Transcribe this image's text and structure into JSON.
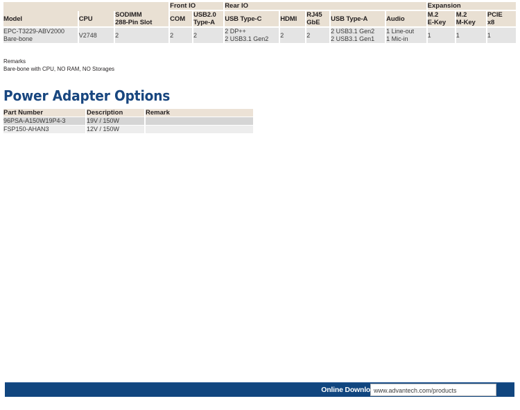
{
  "spec_table": {
    "group_headers": [
      {
        "label": "",
        "colspan": 3,
        "blank": true
      },
      {
        "label": "Front IO",
        "colspan": 2,
        "blank": false
      },
      {
        "label": "Rear IO",
        "colspan": 5,
        "blank": false
      },
      {
        "label": "Expansion",
        "colspan": 3,
        "blank": false
      }
    ],
    "columns": [
      "Model",
      "CPU",
      "SODIMM\n288-Pin Slot",
      "COM",
      "USB2.0\nType-A",
      "USB Type-C",
      "HDMI",
      "RJ45\nGbE",
      "USB Type-A",
      "Audio",
      "M.2\nE-Key",
      "M.2\nM-Key",
      "PCIE\nx8"
    ],
    "rows": [
      {
        "model": "EPC-T3229-ABV2000\nBare-bone",
        "cpu": "V2748",
        "sodimm": "2",
        "com": "2",
        "usb20_type_a": "2",
        "usb_type_c": "2 DP++\n2 USB3.1 Gen2",
        "hdmi": "2",
        "rj45_gbe": "2",
        "usb_type_a": "2 USB3.1 Gen2\n2 USB3.1 Gen1",
        "audio": "1 Line-out\n1 Mic-in",
        "m2_e_key": "1",
        "m2_m_key": "1",
        "pcie_x8": "1"
      }
    ]
  },
  "remarks": {
    "title": "Remarks",
    "text": "Bare-bone with CPU, NO RAM, NO Storages"
  },
  "power_section": {
    "title": "Power Adapter Options",
    "columns": [
      "Part Number",
      "Description",
      "Remark"
    ],
    "rows": [
      {
        "part_number": "96PSA-A150W19P4-3",
        "description": "19V / 150W",
        "remark": ""
      },
      {
        "part_number": "FSP150-AHAN3",
        "description": "12V / 150W",
        "remark": ""
      }
    ]
  },
  "footer": {
    "label": "Online Download",
    "url": "www.advantech.com/products"
  },
  "colors": {
    "header_beige": "#e9e0d3",
    "data_gray": "#e4e4e4",
    "title_blue": "#18467f",
    "footer_blue": "#11467f"
  }
}
